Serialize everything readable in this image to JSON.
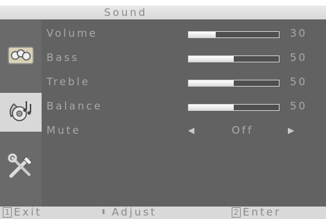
{
  "header": {
    "title": "Sound"
  },
  "sidebar": {
    "tabs": [
      {
        "icon": "picture-icon"
      },
      {
        "icon": "sound-icon"
      },
      {
        "icon": "tools-icon"
      }
    ]
  },
  "settings": {
    "volume": {
      "label": "Volume",
      "value": "30",
      "level": 30
    },
    "bass": {
      "label": "Bass",
      "value": "50",
      "level": 50
    },
    "treble": {
      "label": "Treble",
      "value": "50",
      "level": 50
    },
    "balance": {
      "label": "Balance",
      "value": "50",
      "level": 50
    },
    "mute": {
      "label": "Mute",
      "value": "Off"
    }
  },
  "footer": {
    "exit_key": "1",
    "exit_label": "Exit",
    "adjust_label": "Adjust",
    "enter_key": "2",
    "enter_label": "Enter"
  },
  "colors": {
    "panel": "#626262",
    "text": "#a9a9a9",
    "active_tab": "#d8d8d8"
  }
}
